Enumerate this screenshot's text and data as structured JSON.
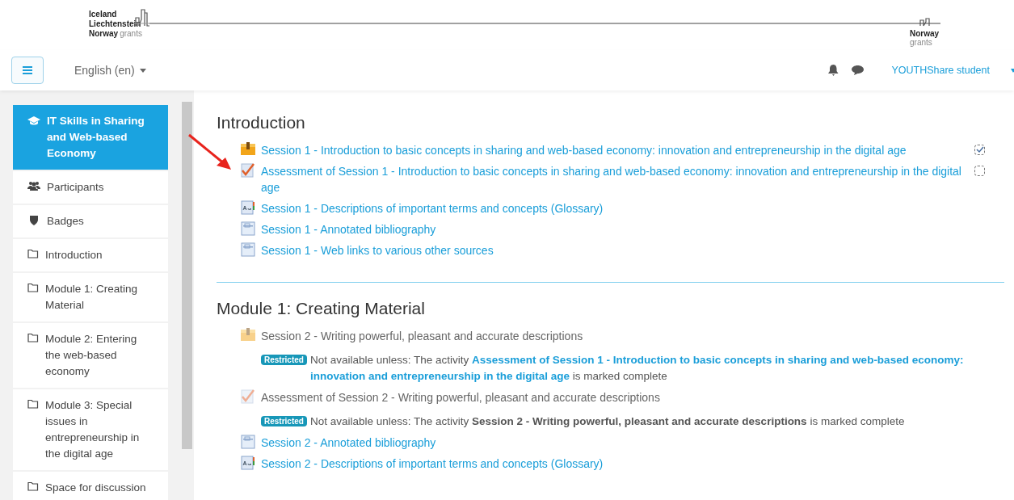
{
  "logo": {
    "left_lines": [
      "Iceland",
      "Liechtenstein",
      "Norway"
    ],
    "left_suffix": "grants",
    "right_lines": [
      "Norway"
    ],
    "right_suffix": "grants"
  },
  "navbar": {
    "language": "English (en)",
    "user": "YOUTHShare student"
  },
  "sidebar": {
    "items": [
      {
        "label": "IT Skills in Sharing and Web-based Economy",
        "kind": "course",
        "selected": true
      },
      {
        "label": "Participants",
        "kind": "participants",
        "selected": false
      },
      {
        "label": "Badges",
        "kind": "badges",
        "selected": false
      },
      {
        "label": "Introduction",
        "kind": "folder",
        "selected": false
      },
      {
        "label": "Module 1: Creating Material",
        "kind": "folder",
        "selected": false
      },
      {
        "label": "Module 2: Entering the web-based economy",
        "kind": "folder",
        "selected": false
      },
      {
        "label": "Module 3: Special issues in entrepreneurship in the digital age",
        "kind": "folder",
        "selected": false
      },
      {
        "label": "Space for discussion",
        "kind": "folder",
        "selected": false
      }
    ]
  },
  "sections": [
    {
      "title": "Introduction",
      "activities": [
        {
          "kind": "package",
          "title": "Session 1 - Introduction to basic concepts in sharing and web-based economy: innovation and entrepreneurship in the digital age",
          "available": true,
          "completion": {
            "checked": true
          }
        },
        {
          "kind": "quiz",
          "title": "Assessment of Session 1 - Introduction to basic concepts in sharing and web-based economy: innovation and entrepreneurship in the digital age",
          "available": true,
          "completion": {
            "checked": false
          }
        },
        {
          "kind": "glossary",
          "title": "Session 1 - Descriptions of important terms and concepts (Glossary)",
          "available": true
        },
        {
          "kind": "page",
          "title": "Session 1 - Annotated bibliography",
          "available": true
        },
        {
          "kind": "page",
          "title": "Session 1 - Web links to various other sources",
          "available": true
        }
      ]
    },
    {
      "title": "Module 1: Creating Material",
      "activities": [
        {
          "kind": "package",
          "title": "Session 2 - Writing powerful, pleasant and accurate descriptions",
          "available": false,
          "restriction": {
            "badge": "Restricted",
            "prefix": "Not available unless: The activity",
            "activity": "Assessment of Session 1 - Introduction to basic concepts in sharing and web-based economy: innovation and entrepreneurship in the digital age",
            "activity_is_link": true,
            "suffix": "is marked complete"
          }
        },
        {
          "kind": "quiz",
          "title": "Assessment of Session 2 - Writing powerful, pleasant and accurate descriptions",
          "available": false,
          "restriction": {
            "badge": "Restricted",
            "prefix": "Not available unless: The activity",
            "activity": "Session 2 - Writing powerful, pleasant and accurate descriptions",
            "activity_is_link": false,
            "suffix": "is marked complete"
          }
        },
        {
          "kind": "page",
          "title": "Session 2 - Annotated bibliography",
          "available": true
        },
        {
          "kind": "glossary",
          "title": "Session 2 - Descriptions of important terms and concepts (Glossary)",
          "available": true
        }
      ]
    }
  ]
}
